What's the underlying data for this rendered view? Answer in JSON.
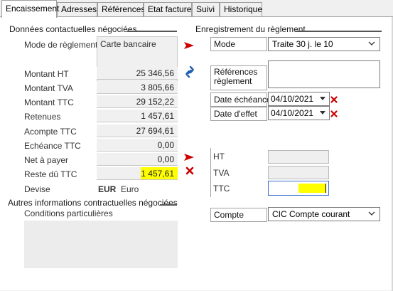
{
  "tabs": [
    {
      "label": "Encaissement",
      "active": true
    },
    {
      "label": "Adresses",
      "active": false
    },
    {
      "label": "Références",
      "active": false
    },
    {
      "label": "Etat facture",
      "active": false
    },
    {
      "label": "Suivi",
      "active": false
    },
    {
      "label": "Historique",
      "active": false
    }
  ],
  "left": {
    "section_title": "Données contactuelles négociées",
    "mode_label": "Mode de règlement",
    "mode_value": "Carte bancaire",
    "rows": [
      {
        "label": "Montant HT",
        "value": "25 346,56"
      },
      {
        "label": "Montant TVA",
        "value": "3 805,66"
      },
      {
        "label": "Montant TTC",
        "value": "29 152,22"
      },
      {
        "label": "Retenues",
        "value": "1 457,61"
      },
      {
        "label": "Acompte TTC",
        "value": "27 694,61"
      },
      {
        "label": "Echéance TTC",
        "value": "0,00"
      },
      {
        "label": "Net à payer",
        "value": "0,00"
      },
      {
        "label": "Reste dû TTC",
        "value": "1 457,61"
      }
    ],
    "devise_label": "Devise",
    "devise_code": "EUR",
    "devise_name": "Euro",
    "other_section_title": "Autres informations contractuelles négociées",
    "conditions_label": "Conditions particulières"
  },
  "right": {
    "section_title": "Enregistrement du règlement",
    "mode_label": "Mode",
    "mode_value": "Traite 30 j. le 10",
    "references_label_line1": "Références",
    "references_label_line2": "règlement",
    "references_value": "",
    "date_echeance_label": "Date échéance",
    "date_echeance_value": "04/10/2021",
    "date_effet_label": "Date d'effet",
    "date_effet_value": "04/10/2021",
    "ht_label": "HT",
    "tva_label": "TVA",
    "ttc_label": "TTC",
    "compte_label": "Compte",
    "compte_value": "CIC Compte courant"
  },
  "colors": {
    "accent_red": "#cc0000",
    "highlight_yellow": "#ffff00",
    "link_blue": "#2060b0"
  },
  "icons": [
    "arrow-right-icon",
    "link-icon",
    "close-icon",
    "chevron-down-icon",
    "dropdown-arrow-icon"
  ]
}
